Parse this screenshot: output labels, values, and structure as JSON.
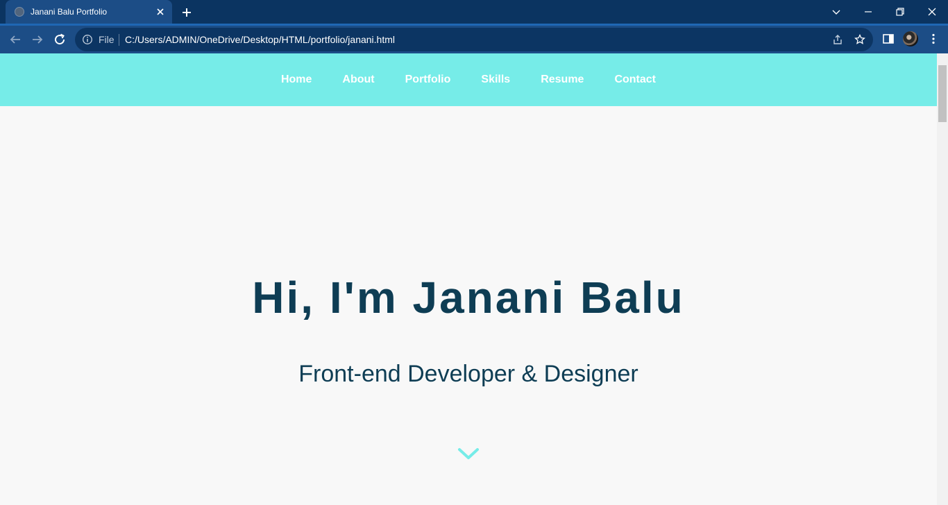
{
  "browser": {
    "tab_title": "Janani Balu Portfolio",
    "address": {
      "scheme_label": "File",
      "url": "C:/Users/ADMIN/OneDrive/Desktop/HTML/portfolio/janani.html"
    },
    "colors": {
      "titlebar": "#0b3461",
      "toolbar": "#1c4d86",
      "omnibox": "#0c3563"
    }
  },
  "site": {
    "nav": {
      "items": [
        {
          "label": "Home"
        },
        {
          "label": "About"
        },
        {
          "label": "Portfolio"
        },
        {
          "label": "Skills"
        },
        {
          "label": "Resume"
        },
        {
          "label": "Contact"
        }
      ],
      "background": "#76ece8"
    },
    "hero": {
      "title": "Hi, I'm Janani Balu",
      "subtitle": "Front-end Developer & Designer",
      "scroll_icon": "chevron-down-icon",
      "text_color": "#0e3d54",
      "accent_color": "#76ece8"
    }
  }
}
